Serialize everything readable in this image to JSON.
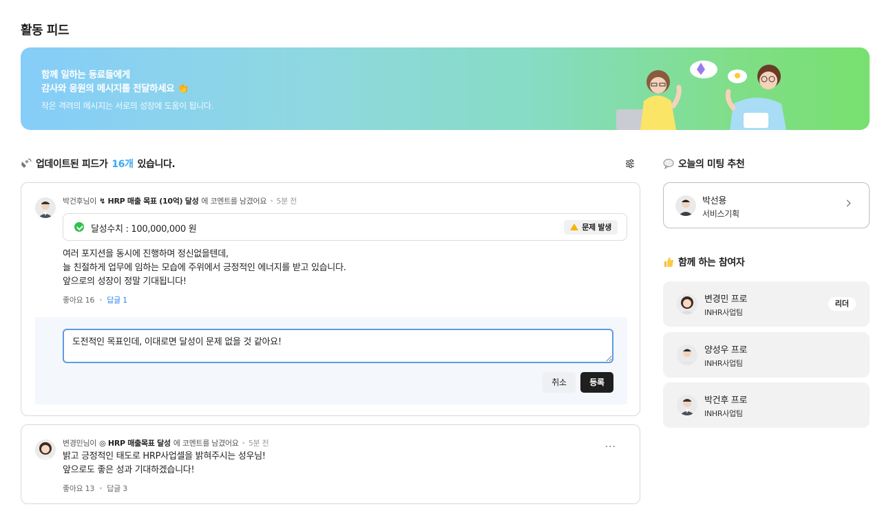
{
  "page": {
    "title": "활동 피드"
  },
  "banner": {
    "line1": "함께 일하는 동료들에게",
    "line2": "감사와 응원의 메시지를 전달하세요 👏",
    "subtitle": "작은 격려의 메시지는 서로의 성장에 도움이 됩니다."
  },
  "feed": {
    "header_prefix": "업데이트된 피드가",
    "count": "16개",
    "header_suffix": "있습니다.",
    "icons": {
      "header": "satellite-icon",
      "filter": "sliders-icon"
    },
    "posts": [
      {
        "author": "박건후님이",
        "goal": "↯ HRP 매출 목표 (10억) 달성",
        "action": "에 코멘트를 남겼어요",
        "time": "5분 전",
        "achievement": "달성수치 : 100,000,000 원",
        "issue_label": "문제 발생",
        "lines": [
          "여러 포지션을 동시에 진행하며 정신없을텐데,",
          "늘 친절하게 업무에 임하는 모습에 주위에서 긍정적인 에너지를 받고 있습니다.",
          "앞으로의 성장이 정말 기대됩니다!"
        ],
        "likes": "좋아요 16",
        "replies": "답글 1",
        "reply_input_value": "도전적인 목표인데, 이대로면 달성이 문제 없을 것 같아요!",
        "cancel_label": "취소",
        "submit_label": "등록"
      },
      {
        "author": "변경민님이",
        "goal": "◎ HRP 매출목표 달성",
        "action": "에 코멘트를 남겼어요",
        "time": "5분 전",
        "more": "···",
        "lines": [
          "밝고 긍정적인 태도로 HRP사업셀을 밝혀주시는 성우님!",
          "앞으로도 좋은 성과 기대하겠습니다!"
        ],
        "likes": "좋아요 13",
        "replies": "답글 3"
      }
    ]
  },
  "meeting": {
    "title": "오늘의 미팅 추천",
    "icon": "speech-bubble-icon",
    "person": {
      "name": "박선용",
      "team": "서비스기획"
    }
  },
  "participants": {
    "title": "함께 하는 참여자",
    "icon": "thumbs-up-icon",
    "items": [
      {
        "name": "변경민 프로",
        "team": "INHR사업팀",
        "badge": "리더"
      },
      {
        "name": "양성우 프로",
        "team": "INHR사업팀"
      },
      {
        "name": "박건후 프로",
        "team": "INHR사업팀"
      }
    ]
  },
  "colors": {
    "accent_blue": "#38a9f1",
    "reply_blue": "#2a83e8",
    "focus_border": "#5b9ae6",
    "success_green": "#2fc250",
    "warning_yellow": "#f5b400"
  }
}
